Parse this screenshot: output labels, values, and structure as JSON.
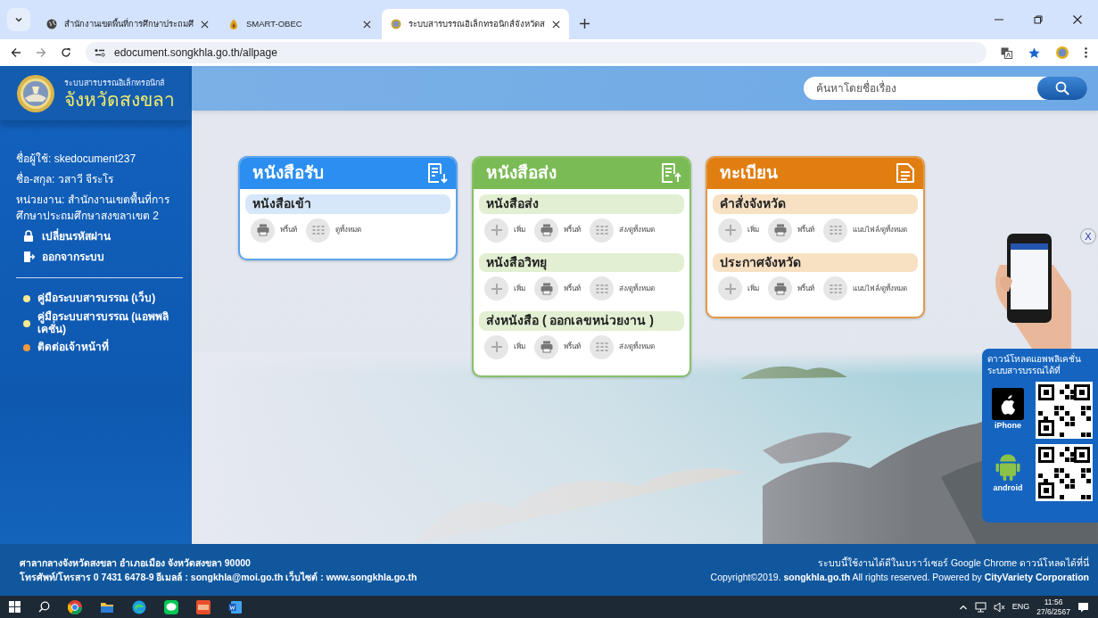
{
  "browser": {
    "tabs": [
      {
        "title": "สำนักงานเขตพื้นที่การศึกษาประถมศึ",
        "selected": false
      },
      {
        "title": "SMART-OBEC",
        "selected": false
      },
      {
        "title": "ระบบสารบรรณอิเล็กทรอนิกส์จังหวัดส",
        "selected": true
      }
    ],
    "address": "edocument.songkhla.go.th/allpage"
  },
  "sidebar": {
    "brand_small": "ระบบสารบรรณอิเล็กทรอนิกส์",
    "brand": "จังหวัดสงขลา",
    "user_lines": [
      "ชื่อผู้ใช้: skedocument237",
      "ชื่อ-สกุล: วสาวี จีระโร",
      "หน่วยงาน: สำนักงานเขตพื้นที่การศึกษาประถมศึกษาสงขลาเขต 2"
    ],
    "account_links": [
      {
        "kind": "lock",
        "label": "เปลี่ยนรหัสผ่าน"
      },
      {
        "kind": "logout",
        "label": "ออกจากระบบ"
      }
    ],
    "help_links": [
      {
        "label": "คู่มือระบบสารบรรณ (เว็บ)",
        "color": "#f7ea8f"
      },
      {
        "label": "คู่มือระบบสารบรรณ (แอพพลิเคชั่น)",
        "color": "#f7ea8f"
      },
      {
        "label": "ติดต่อเจ้าหน้าที่",
        "color": "#f39a3a"
      }
    ]
  },
  "search": {
    "placeholder": "ค้นหาโดยชื่อเรื่อง"
  },
  "cards": [
    {
      "kind": "incoming",
      "title": "หนังสือรับ",
      "sections": [
        {
          "title": "หนังสือเข้า",
          "actions": [
            {
              "kind": "print",
              "label": "พริ้นท์"
            },
            {
              "kind": "list",
              "label": "ดูทั้งหมด"
            }
          ]
        }
      ]
    },
    {
      "kind": "outgoing",
      "title": "หนังสือส่ง",
      "sections": [
        {
          "title": "หนังสือส่ง",
          "actions": [
            {
              "kind": "add",
              "label": "เพิ่ม"
            },
            {
              "kind": "print",
              "label": "พริ้นท์"
            },
            {
              "kind": "list",
              "label": "ส่ง/ดูทั้งหมด"
            }
          ]
        },
        {
          "title": "หนังสือวิทยุ",
          "actions": [
            {
              "kind": "add",
              "label": "เพิ่ม"
            },
            {
              "kind": "print",
              "label": "พริ้นท์"
            },
            {
              "kind": "list",
              "label": "ส่ง/ดูทั้งหมด"
            }
          ]
        },
        {
          "title": "ส่งหนังสือ ( ออกเลขหน่วยงาน )",
          "actions": [
            {
              "kind": "add",
              "label": "เพิ่ม"
            },
            {
              "kind": "print",
              "label": "พริ้นท์"
            },
            {
              "kind": "list",
              "label": "ส่ง/ดูทั้งหมด"
            }
          ]
        }
      ]
    },
    {
      "kind": "register",
      "title": "ทะเบียน",
      "sections": [
        {
          "title": "คำสั่งจังหวัด",
          "actions": [
            {
              "kind": "add",
              "label": "เพิ่ม"
            },
            {
              "kind": "print",
              "label": "พริ้นท์"
            },
            {
              "kind": "list",
              "label": "แนบไฟล์/ดูทั้งหมด"
            }
          ]
        },
        {
          "title": "ประกาศจังหวัด",
          "actions": [
            {
              "kind": "add",
              "label": "เพิ่ม"
            },
            {
              "kind": "print",
              "label": "พริ้นท์"
            },
            {
              "kind": "list",
              "label": "แนบไฟล์/ดูทั้งหมด"
            }
          ]
        }
      ]
    }
  ],
  "app_panel": {
    "close": "X",
    "lines": [
      "ดาวน์โหลดแอพพลิเคชั่น",
      "ระบบสารบรรณได้ที่"
    ],
    "platforms": [
      {
        "kind": "apple",
        "label": "iPhone"
      },
      {
        "kind": "android",
        "label": "android"
      }
    ]
  },
  "footer": {
    "left": [
      "ศาลากลางจังหวัดสงขลา อำเภอเมือง จังหวัดสงขลา 90000",
      "โทรศัพท์/โทรสาร 0 7431 6478-9 อีเมลล์ : songkhla@moi.go.th เว็บไซต์ : www.songkhla.go.th"
    ],
    "right": [
      "ระบบนี้ใช้งานได้ดีในเบราว์เซอร์ Google Chrome ดาวน์โหลดได้ที่นี่",
      "Copyright©2019. **songkhla.go.th** All rights reserved. Powered by **CityVariety Corporation**"
    ]
  },
  "taskbar": {
    "apps": [
      {
        "kind": "browser"
      },
      {
        "kind": "folder"
      },
      {
        "kind": "edge"
      },
      {
        "kind": "chat"
      },
      {
        "kind": "app"
      },
      {
        "kind": "word"
      }
    ],
    "language": "ENG",
    "time": "11:56",
    "date": "27/6/2567"
  }
}
